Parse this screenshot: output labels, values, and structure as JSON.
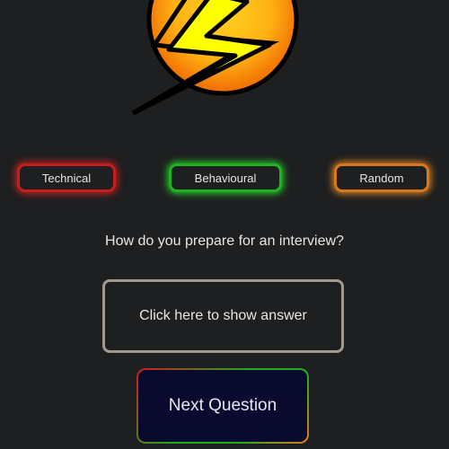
{
  "logo": {
    "icon": "lightning-bolt-icon",
    "colors": {
      "circle_inner": "#ffc21a",
      "circle_outer": "#f07a00",
      "bolt": "#ffff00",
      "outline": "#000000"
    }
  },
  "categories": {
    "technical": {
      "label": "Technical",
      "glow_color": "#dc1e1e"
    },
    "behavioural": {
      "label": "Behavioural",
      "glow_color": "#28dc28"
    },
    "random": {
      "label": "Random",
      "glow_color": "#f08c1e"
    }
  },
  "question": {
    "text": "How do you prepare for an interview?"
  },
  "answer": {
    "prompt": "Click here to show answer"
  },
  "next_button": {
    "label": "Next Question"
  },
  "colors": {
    "background": "#1e1f21",
    "text": "#e6e6e6",
    "answer_border": "#a39a8e",
    "next_button_fill": "#0a0a2e"
  }
}
